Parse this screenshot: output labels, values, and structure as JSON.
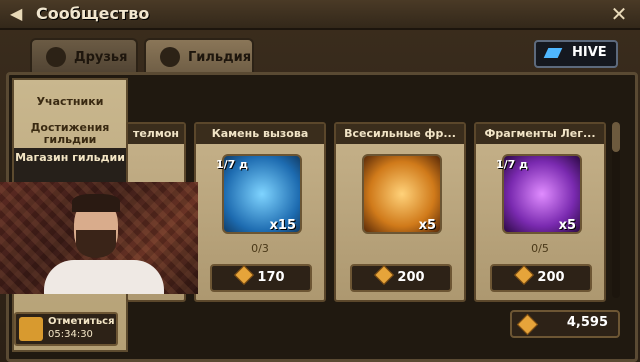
{
  "window": {
    "title": "Сообщество"
  },
  "tabs": [
    {
      "label": "Друзья",
      "active": false
    },
    {
      "label": "Гильдия",
      "active": true
    }
  ],
  "hive_button": {
    "label": "HIVE"
  },
  "menu": {
    "items": [
      {
        "label": "Участники"
      },
      {
        "label": "Достижения гильдии"
      },
      {
        "label": "Магазин гильдии",
        "active": true
      }
    ]
  },
  "shop": {
    "items": [
      {
        "name": "Камень вызова",
        "timer": "1/7 д",
        "quantity": "x15",
        "limit": "0/3",
        "price": "170"
      },
      {
        "name": "Всесильные фр...",
        "timer": "",
        "quantity": "x5",
        "limit": "",
        "price": "200"
      },
      {
        "name": "Фрагменты Лег...",
        "timer": "1/7 д",
        "quantity": "x5",
        "limit": "0/5",
        "price": "200"
      }
    ],
    "partial_item_name": "телмон"
  },
  "balance": {
    "value": "4,595"
  },
  "checkin": {
    "label": "Отметиться",
    "timer": "05:34:30"
  },
  "colors": {
    "accent": "#e6a43a",
    "hive": "#4fb7ff"
  }
}
